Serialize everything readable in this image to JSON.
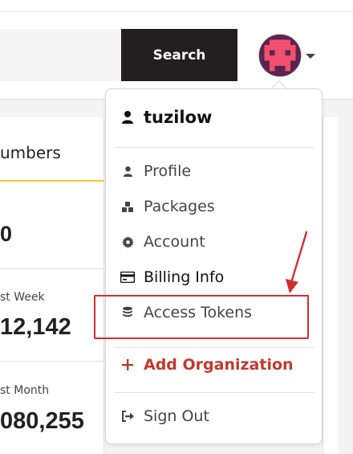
{
  "header": {
    "search_placeholder": "",
    "search_button": "Search"
  },
  "stats_card": {
    "title": "umbers",
    "rows": [
      {
        "label": "",
        "value": "0"
      },
      {
        "label": "st Week",
        "value": "12,142"
      },
      {
        "label": "st Month",
        "value": "080,255"
      }
    ]
  },
  "user_menu": {
    "username": "tuzilow",
    "items": [
      {
        "label": "Profile",
        "icon": "user-icon"
      },
      {
        "label": "Packages",
        "icon": "cubes-icon"
      },
      {
        "label": "Account",
        "icon": "gear-icon"
      },
      {
        "label": "Billing Info",
        "icon": "credit-card-icon"
      },
      {
        "label": "Access Tokens",
        "icon": "coins-icon"
      }
    ],
    "add_org": "Add Organization",
    "sign_out": "Sign Out"
  },
  "colors": {
    "accent_red": "#c0392b",
    "highlight": "#d32f2f",
    "button_dark": "#231f20",
    "tab_underline": "#f0c63a"
  }
}
